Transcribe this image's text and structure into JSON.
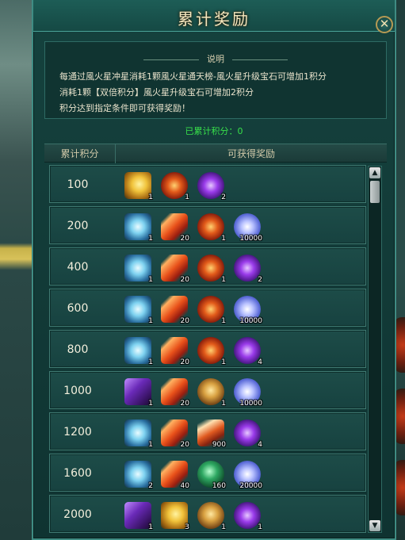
{
  "window": {
    "title": "累计奖励",
    "close_label": "✕"
  },
  "description": {
    "heading": "说明",
    "lines": [
      "每通过風火星冲星消耗1颗風火星通天榜-風火星升级宝石可增加1积分",
      "消耗1颗【双倍积分】風火星升级宝石可增加2积分",
      "积分达到指定条件即可获得奖励！"
    ]
  },
  "score_line": "已累计积分：0",
  "table": {
    "col_points": "累计积分",
    "col_rewards": "可获得奖励",
    "rows": [
      {
        "points": "100",
        "items": [
          {
            "icon": "gold-wind-icon",
            "count": "1"
          },
          {
            "icon": "fire-orb-icon",
            "count": "1"
          },
          {
            "icon": "purple-gem-icon",
            "count": "2"
          }
        ]
      },
      {
        "points": "200",
        "items": [
          {
            "icon": "wind-icon",
            "count": "1"
          },
          {
            "icon": "feather-icon",
            "count": "20"
          },
          {
            "icon": "fire-orb-icon",
            "count": "1"
          },
          {
            "icon": "crystal-icon",
            "count": "10000"
          }
        ]
      },
      {
        "points": "400",
        "items": [
          {
            "icon": "wind-icon",
            "count": "1"
          },
          {
            "icon": "feather-icon",
            "count": "20"
          },
          {
            "icon": "fire-orb-icon",
            "count": "1"
          },
          {
            "icon": "purple-gem-icon",
            "count": "2"
          }
        ]
      },
      {
        "points": "600",
        "items": [
          {
            "icon": "wind-icon",
            "count": "1"
          },
          {
            "icon": "feather-icon",
            "count": "20"
          },
          {
            "icon": "fire-orb-icon",
            "count": "1"
          },
          {
            "icon": "crystal-icon",
            "count": "10000"
          }
        ]
      },
      {
        "points": "800",
        "items": [
          {
            "icon": "wind-icon",
            "count": "1"
          },
          {
            "icon": "feather-icon",
            "count": "20"
          },
          {
            "icon": "fire-orb-icon",
            "count": "1"
          },
          {
            "icon": "purple-gem-icon",
            "count": "4"
          }
        ]
      },
      {
        "points": "1000",
        "items": [
          {
            "icon": "purple-box-icon",
            "count": "1"
          },
          {
            "icon": "feather-icon",
            "count": "20"
          },
          {
            "icon": "shell-icon",
            "count": "1"
          },
          {
            "icon": "crystal-icon",
            "count": "10000"
          }
        ]
      },
      {
        "points": "1200",
        "items": [
          {
            "icon": "wind-icon",
            "count": "1"
          },
          {
            "icon": "feather-icon",
            "count": "20"
          },
          {
            "icon": "sword-icon",
            "count": "900"
          },
          {
            "icon": "purple-gem-icon",
            "count": "4"
          }
        ]
      },
      {
        "points": "1600",
        "items": [
          {
            "icon": "wind-icon",
            "count": "2"
          },
          {
            "icon": "feather-icon",
            "count": "40"
          },
          {
            "icon": "green-orb-icon",
            "count": "160"
          },
          {
            "icon": "crystal-icon",
            "count": "20000"
          }
        ]
      },
      {
        "points": "2000",
        "items": [
          {
            "icon": "purple-box-icon",
            "count": "1"
          },
          {
            "icon": "gold-wind-icon",
            "count": "3"
          },
          {
            "icon": "shell-icon",
            "count": "1"
          },
          {
            "icon": "purple-gem-icon",
            "count": "1"
          }
        ]
      }
    ]
  },
  "scroll": {
    "up": "▲",
    "down": "▼"
  }
}
